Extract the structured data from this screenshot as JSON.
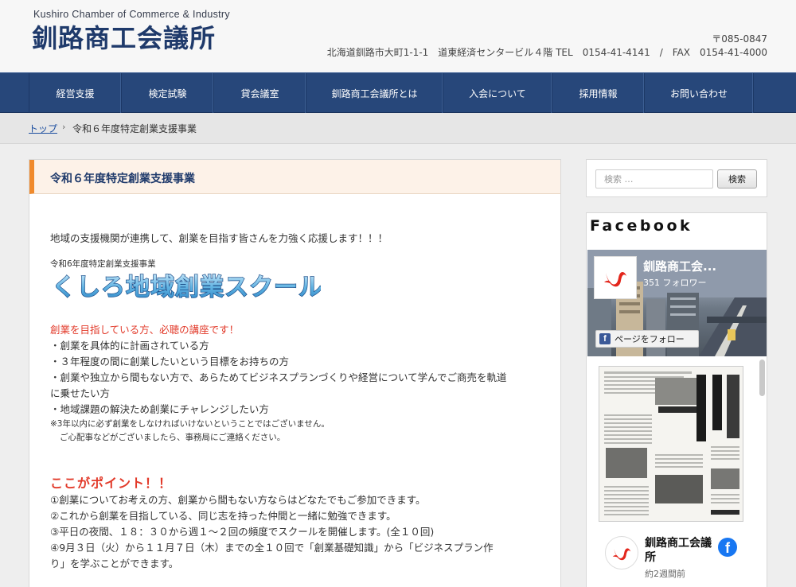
{
  "header": {
    "logo_en": "Kushiro Chamber of Commerce & Industry",
    "logo_jp": "釧路商工会議所",
    "postal": "〒085-0847",
    "address": "北海道釧路市大町1-1-1　道東経済センタービル４階 TEL　0154-41-4141　/　FAX　0154-41-4000"
  },
  "nav": {
    "items": [
      {
        "label": "経営支援"
      },
      {
        "label": "検定試験"
      },
      {
        "label": "貸会議室"
      },
      {
        "label": "釧路商工会議所とは"
      },
      {
        "label": "入会について"
      },
      {
        "label": "採用情報"
      },
      {
        "label": "お問い合わせ"
      }
    ]
  },
  "breadcrumb": {
    "home": "トップ",
    "separator": "›",
    "current": "令和６年度特定創業支援事業"
  },
  "main": {
    "title": "令和６年度特定創業支援事業",
    "intro": "地域の支援機関が連携して、創業を目指す皆さんを力強く応援します！！！",
    "banner_caption": "令和6年度特定創業支援事業",
    "banner_text": "くしろ地域創業スクール",
    "target_heading": "創業を目指している方、必聴の講座です！",
    "targets": [
      "・創業を具体的に計画されている方",
      "・３年程度の間に創業したいという目標をお持ちの方",
      "・創業や独立から間もない方で、あらためてビジネスプランづくりや経営について学んでご商売を軌道",
      "に乗せたい方",
      "・地域課題の解決ため創業にチャレンジしたい方"
    ],
    "notes": [
      "※3年以内に必ず創業をしなければいけないということではございません。",
      "ご心配事などがございましたら、事務局にご連絡ください。"
    ],
    "points_heading": "ここがポイント！！",
    "points": [
      "①創業についてお考えの方、創業から間もない方ならはどなたでもご参加できます。",
      "②これから創業を目指している、同じ志を持った仲間と一緒に勉強できます。",
      "③平日の夜間、１８：３０から週１～２回の頻度でスクールを開催します。(全１０回)",
      "④9月３日（火）から１１月７日（木）までの全１０回で「創業基礎知識」から「ビジネスプラン作",
      "り」を学ぶことができます。"
    ]
  },
  "sidebar": {
    "search": {
      "placeholder": "検索 …",
      "button": "検索"
    },
    "facebook": {
      "heading": "Facebook",
      "page_name": "釧路商工会...",
      "followers": "351 フォロワー",
      "follow_button": "ページをフォロー",
      "post_author": "釧路商工会議所",
      "post_time": "約2週間前"
    }
  },
  "colors": {
    "nav_bg": "#27477a",
    "accent_orange": "#f08a2c",
    "title_navy": "#1f3a6b",
    "alert_red": "#e23a2a",
    "facebook_blue": "#1877f2"
  },
  "icons": [
    "chevron-right-icon",
    "facebook-f-icon",
    "chamber-logo-icon"
  ]
}
